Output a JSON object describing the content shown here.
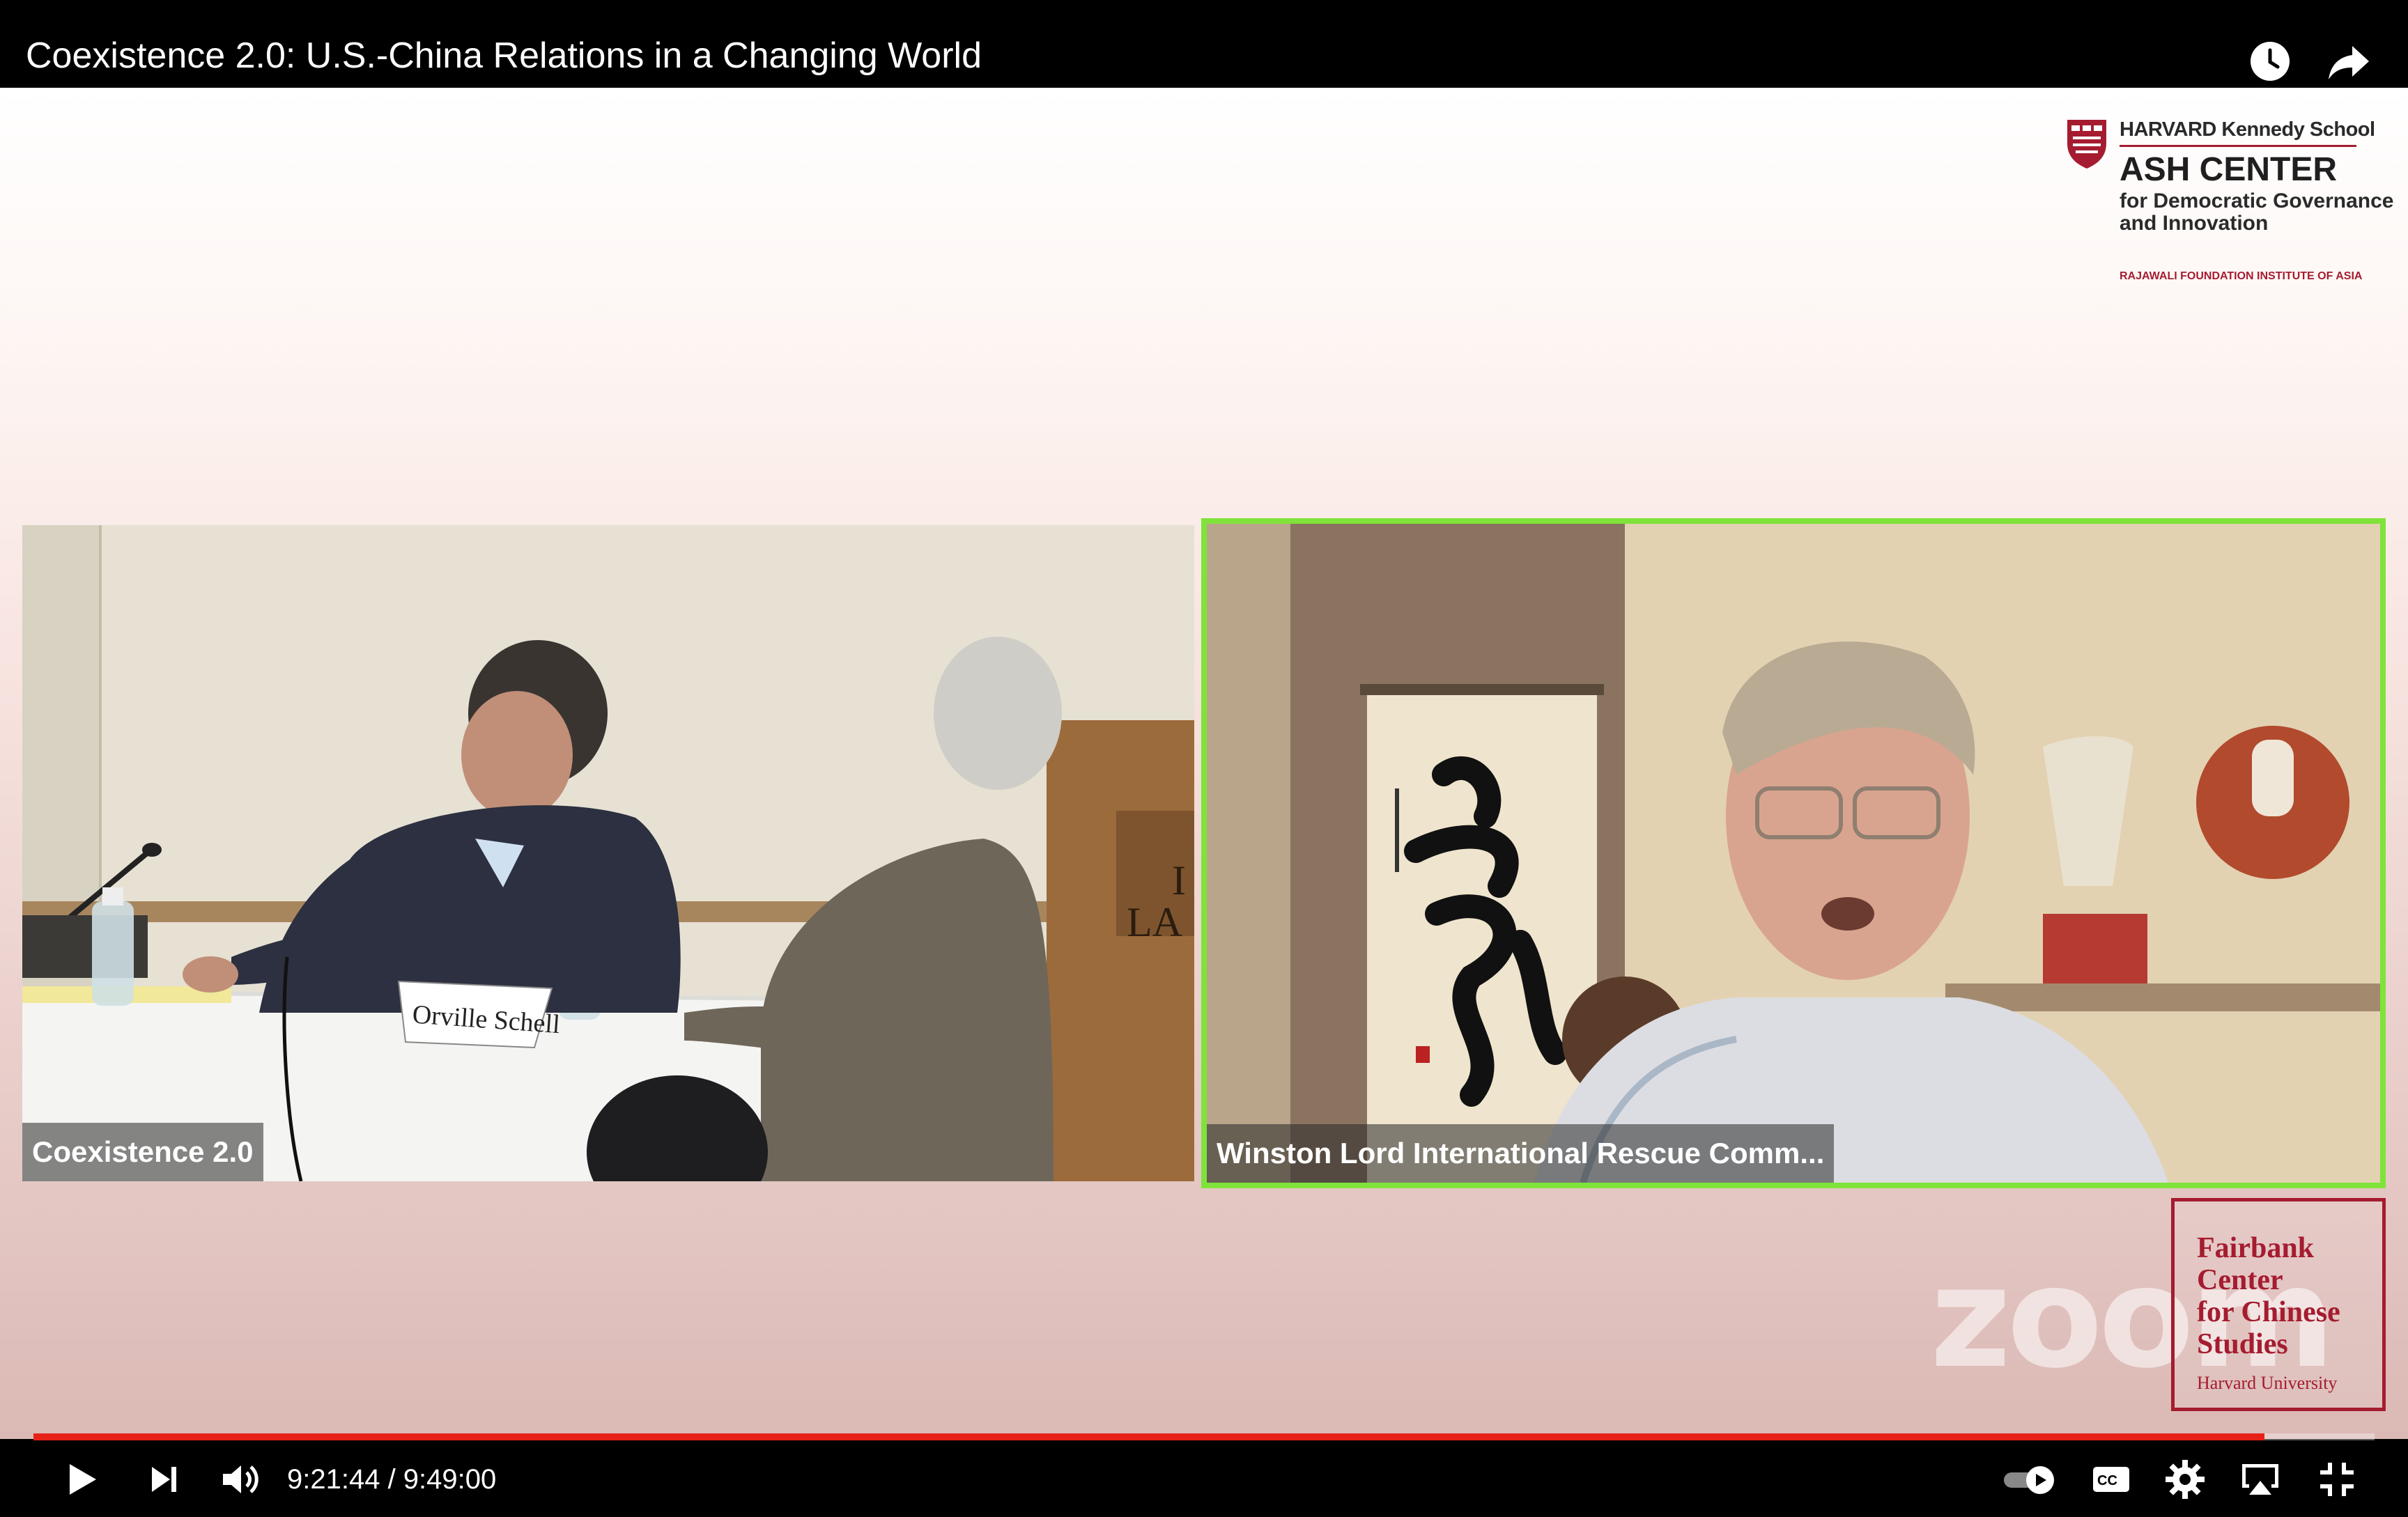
{
  "video": {
    "title": "Coexistence 2.0: U.S.-China Relations in a Changing World"
  },
  "top_controls": {
    "watch_later_icon": "clock-icon",
    "share_icon": "share-arrow-icon"
  },
  "hks_logo": {
    "school": "HARVARD Kennedy School",
    "center": "ASH CENTER",
    "subtitle_line1": "for Democratic Governance",
    "subtitle_line2": "and Innovation",
    "institute": "RAJAWALI FOUNDATION INSTITUTE OF ASIA"
  },
  "tiles": {
    "panel": {
      "label": "Coexistence 2.0",
      "name_card": "Orville Schell",
      "podium_text_1": "I",
      "podium_text_2": "LA"
    },
    "speaker": {
      "label": "Winston Lord International Rescue Comm..."
    }
  },
  "watermark": {
    "zoom": "zoom"
  },
  "fairbank_logo": {
    "line1": "Fairbank",
    "line2": "Center",
    "line3": "for Chinese",
    "line4": "Studies",
    "university": "Harvard University"
  },
  "player": {
    "current_time": "9:21:44",
    "duration": "9:49:00",
    "time_display": "9:21:44 / 9:49:00",
    "progress_fraction": 0.953,
    "accent_color": "#e62117"
  }
}
